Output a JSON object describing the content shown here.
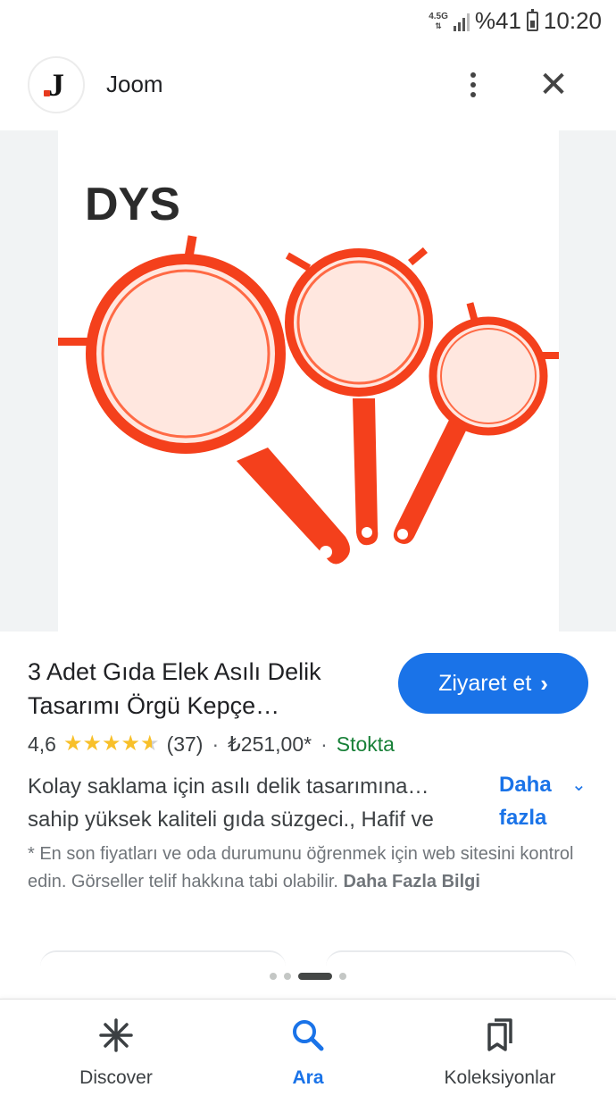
{
  "status_bar": {
    "network": "4.5G",
    "battery": "%41",
    "time": "10:20"
  },
  "app_header": {
    "app_name": "Joom",
    "logo_letter": "J",
    "more_icon": "more-vert-icon",
    "close_icon": "close-icon",
    "close_glyph": "✕"
  },
  "product_image": {
    "description_icon": "product-image",
    "brand_logo_text": "DYS"
  },
  "product": {
    "title": "3 Adet Gıda Elek Asılı Delik Tasarımı Örgü Kepçe…",
    "visit_label": "Ziyaret et",
    "visit_chevron": "›",
    "rating": "4,6",
    "rating_stars": 4.6,
    "review_count": "(37)",
    "separator": "·",
    "price": "₺251,00*",
    "stock": "Stokta",
    "description": "Kolay saklama için asılı delik tasarımına… sahip yüksek kaliteli gıda süzgeci., Hafif ve",
    "more_label": "Daha fazla",
    "more_chevron": "⌄"
  },
  "disclaimer": {
    "text": "* En son fiyatları ve oda durumunu öğrenmek için web sitesini kontrol edin. Görseller telif hakkına tabi olabilir.",
    "link": "Daha Fazla Bilgi"
  },
  "carousel": {
    "dot_count": 4,
    "active_index": 2
  },
  "bottom_nav": {
    "items": [
      {
        "label": "Discover",
        "icon": "asterisk-icon",
        "active": false
      },
      {
        "label": "Ara",
        "icon": "search-icon",
        "active": true
      },
      {
        "label": "Koleksiyonlar",
        "icon": "collections-icon",
        "active": false
      }
    ]
  },
  "colors": {
    "accent": "#1a73e8",
    "stock_green": "#188038",
    "star": "#f8c02a",
    "strainer_red": "#f4401c"
  }
}
